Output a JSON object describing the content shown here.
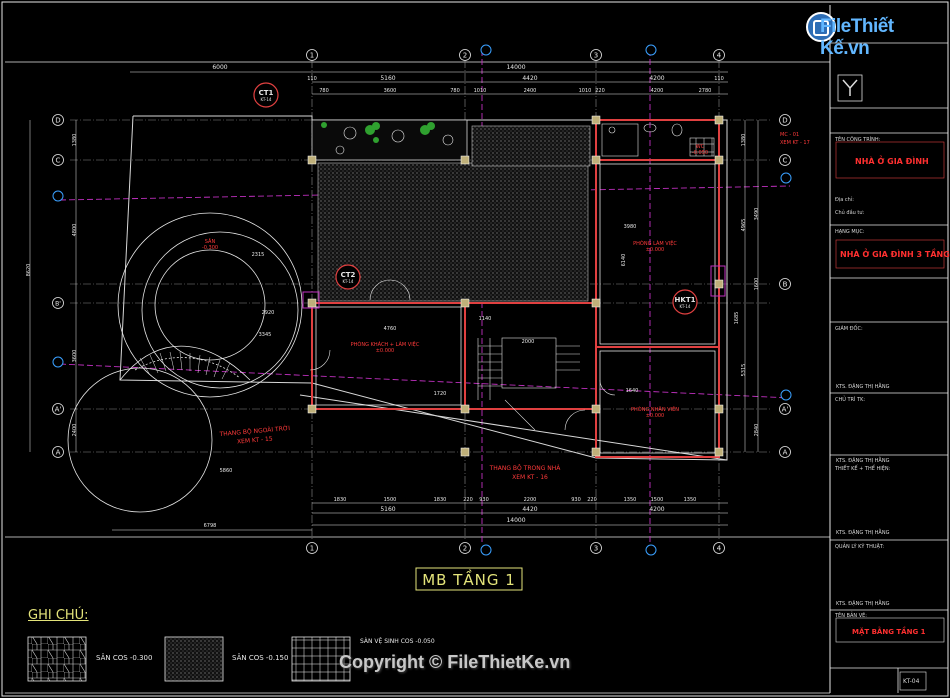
{
  "brand": {
    "logo_text": "FileThiết Kế",
    "logo_suffix": ".vn",
    "copyright": "Copyright © FileThietKe.vn"
  },
  "drawing": {
    "title": "MB TẦNG 1",
    "notes_heading": "GHI CHÚ:",
    "legend": [
      {
        "label": "SÂN COS -0.300"
      },
      {
        "label": "SÂN COS -0.150"
      },
      {
        "label": "SÀN VỆ SINH COS -0.050"
      }
    ],
    "axes_top": [
      "1",
      "2",
      "3",
      "4"
    ],
    "axes_left": [
      "D",
      "C",
      "B'",
      "B",
      "A'",
      "A"
    ],
    "dims_top_total": "14000",
    "dims_top": [
      "5160",
      "4420",
      "4200"
    ],
    "dims_top_sub": [
      "780",
      "3600",
      "780",
      "1010",
      "2400",
      "1010",
      "220",
      "4200",
      "2780"
    ],
    "dims_outer": [
      "6000",
      "110",
      "110"
    ],
    "dims_bottom_total": "14000",
    "dims_bottom": [
      "5160",
      "4420",
      "4200"
    ],
    "dims_bottom_sub": [
      "1830",
      "1500",
      "1830",
      "220",
      "930",
      "2200",
      "930",
      "220",
      "1350",
      "1500",
      "1350"
    ],
    "dims_left": [
      "1380",
      "4800",
      "8620",
      "3600",
      "2400"
    ],
    "dims_right": [
      "1380",
      "3490",
      "4965",
      "1600",
      "5315",
      "2840"
    ],
    "dim_6798": "6798",
    "dim_5860": "5860",
    "tags": [
      {
        "name": "CT1",
        "sub": "KT-14"
      },
      {
        "name": "CT2",
        "sub": "KT-14"
      },
      {
        "name": "HKT1",
        "sub": "KT-14"
      }
    ],
    "rooms": [
      {
        "name": "SÂN",
        "level": "-0.300"
      },
      {
        "name": "PHÒNG KHÁCH + LÀM VIỆC",
        "level": "±0.000"
      },
      {
        "name": "PHÒNG LÀM VIỆC",
        "level": "±0.000"
      },
      {
        "name": "PHÒNG NHÂN VIÊN",
        "level": "±0.000"
      },
      {
        "name": "WC",
        "level": "-0.050"
      }
    ],
    "stair_labels": [
      {
        "name": "THANG BỘ NGOÀI TRỜI",
        "ref": "XEM KT - 15"
      },
      {
        "name": "THANG BỘ TRONG NHÀ",
        "ref": "XEM KT - 16"
      }
    ],
    "section_ref": {
      "text": "MC - 01",
      "ref": "XEM KT - 17"
    },
    "misc_dims": [
      "2000",
      "1140",
      "1720",
      "4760",
      "3980",
      "6140",
      "1685",
      "1640",
      "2920",
      "3345",
      "2315"
    ]
  },
  "title_block": {
    "project_label": "TÊN CÔNG TRÌNH:",
    "project": "NHÀ Ở GIA ĐÌNH",
    "address_label": "Địa chỉ:",
    "owner_label": "Chủ đầu tư:",
    "item_label": "HẠNG MỤC:",
    "item": "NHÀ Ở GIA ĐÌNH 3 TẦNG",
    "director_label": "GIÁM ĐỐC:",
    "director": "KTS. ĐẶNG THỊ HẰNG",
    "chief_label": "CHỦ TRÌ TK:",
    "chief": "KTS. ĐẶNG THỊ HẰNG",
    "designer_label": "THIẾT KẾ + THỂ HIỆN:",
    "designer": "KTS. ĐẶNG THỊ HẰNG",
    "qa_label": "QUẢN LÝ KỸ THUẬT:",
    "qa": "KTS. ĐẶNG THỊ HẰNG",
    "sheet_label": "TÊN BẢN VẼ:",
    "sheet": "MẶT BẰNG TẦNG 1",
    "sheet_no": "KT-04"
  }
}
